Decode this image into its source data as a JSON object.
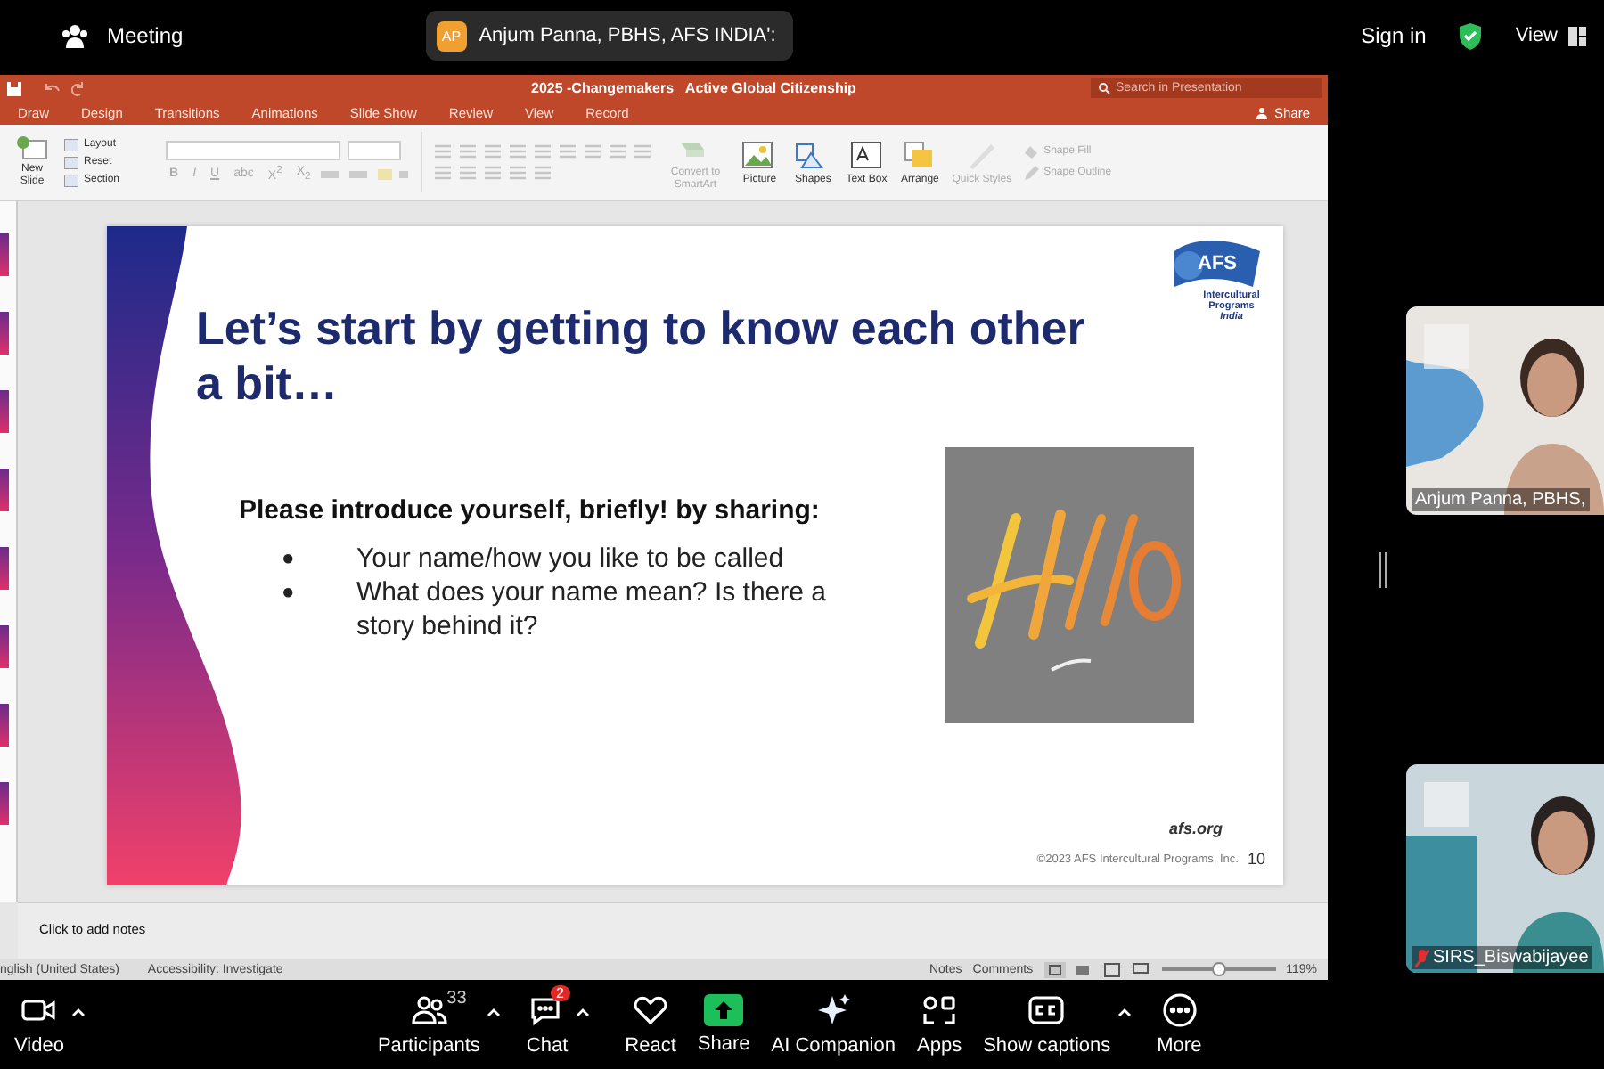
{
  "meeting_bar": {
    "title": "Meeting",
    "speaker": {
      "initials": "AP",
      "name": "Anjum Panna, PBHS, AFS INDIA':"
    },
    "sign_in": "Sign in",
    "view": "View"
  },
  "powerpoint": {
    "title": "2025 -Changemakers_ Active Global Citizenship",
    "search": {
      "placeholder": "Search in Presentation"
    },
    "share": "Share",
    "tabs": [
      "Draw",
      "Design",
      "Transitions",
      "Animations",
      "Slide Show",
      "Review",
      "View",
      "Record"
    ],
    "ribbon": {
      "new_slide": "New Slide",
      "slide_items": [
        "Layout",
        "Reset",
        "Section"
      ],
      "format_buttons": [
        {
          "label": "B",
          "disabled": true
        },
        {
          "label": "I",
          "disabled": true
        },
        {
          "label": "U",
          "disabled": true
        },
        {
          "label": "abc",
          "disabled": true
        },
        {
          "label": "X$^{2}$",
          "disabled": true
        },
        {
          "label": "X$_{2}$",
          "disabled": true
        }
      ],
      "tools": [
        {
          "label": "Convert to SmartArt",
          "kind": "smartart",
          "disabled": true
        },
        {
          "label": "Picture",
          "kind": "picture",
          "disabled": false
        },
        {
          "label": "Shapes",
          "kind": "shapes",
          "disabled": false
        },
        {
          "label": "Text Box",
          "kind": "textbox",
          "disabled": false
        },
        {
          "label": "Arrange",
          "kind": "arrange",
          "disabled": false
        },
        {
          "label": "Quick Styles",
          "kind": "styles",
          "disabled": true
        }
      ],
      "shape_items": [
        {
          "label": "Shape Fill",
          "kind": "fill",
          "disabled": true
        },
        {
          "label": "Shape Outline",
          "kind": "outline",
          "disabled": true
        }
      ]
    },
    "slide": {
      "logo": {
        "name": "AFS",
        "line1": "Intercultural",
        "line2": "Programs",
        "line3": "India"
      },
      "title": "Let’s start by getting to know each other a bit…",
      "prompt": "Please introduce yourself, briefly! by sharing:",
      "bullets": [
        {
          "marker": "●",
          "text": "Your name/how you like to be called"
        },
        {
          "marker": "●",
          "text": "What does your name mean? Is there a story behind it?"
        }
      ],
      "site": "afs.org",
      "copyright": "©2023 AFS Intercultural Programs, Inc.",
      "number": "10"
    },
    "notes_placeholder": "Click to add notes",
    "status_bar": {
      "language": "nglish (United States)",
      "accessibility": "Accessibility: Investigate",
      "notes": "Notes",
      "comments": "Comments",
      "zoom": {
        "level": 0.5
      },
      "zoom_text": "119%"
    }
  },
  "videos": [
    {
      "name": "Anjum Panna, PBHS,",
      "muted": false
    },
    {
      "name": "SIRS_Biswabijayee",
      "muted": true
    }
  ],
  "toolbar": [
    {
      "label": "Video",
      "kind": "video",
      "caret": true
    },
    {
      "label": "Participants",
      "kind": "participants",
      "count": "33",
      "caret": true
    },
    {
      "label": "Chat",
      "kind": "chat",
      "badge": "2",
      "caret": true
    },
    {
      "label": "React",
      "kind": "react",
      "caret": false
    },
    {
      "label": "Share",
      "kind": "share",
      "caret": false
    },
    {
      "label": "AI Companion",
      "kind": "ai",
      "caret": false
    },
    {
      "label": "Apps",
      "kind": "apps",
      "caret": false
    },
    {
      "label": "Show captions",
      "kind": "captions",
      "caret": true
    },
    {
      "label": "More",
      "kind": "more",
      "caret": false
    }
  ]
}
